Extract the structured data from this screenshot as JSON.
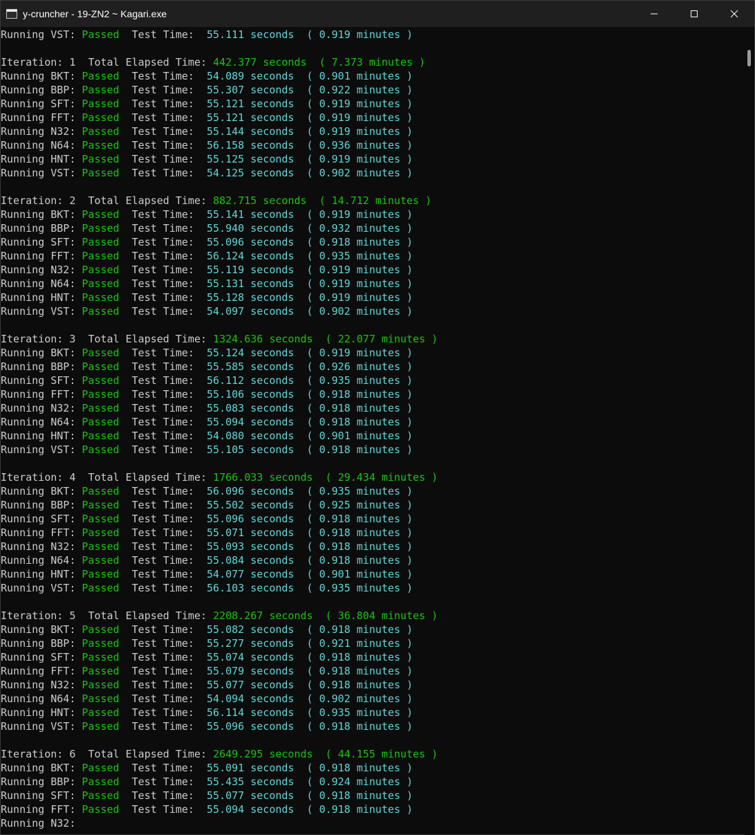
{
  "window": {
    "title": "y-cruncher - 19-ZN2 ~ Kagari.exe",
    "icon": "console-window-icon",
    "controls": [
      "minimize-icon",
      "maximize-icon",
      "close-icon"
    ]
  },
  "colors": {
    "background": "#0c0c0c",
    "titlebar": "#1f1f1f",
    "text": "#cccccc",
    "passed": "#16c60c",
    "time": "#61d6d6"
  },
  "labels": {
    "running": "Running",
    "passed": "Passed",
    "test_time": "Test Time:",
    "seconds": "seconds",
    "minutes": "minutes",
    "iteration": "Iteration:",
    "total_elapsed": "Total Elapsed Time:"
  },
  "terminal": {
    "lines": [
      {
        "type": "test",
        "test": "VST",
        "seconds": "55.111",
        "minutes": "0.919"
      },
      {
        "type": "blank"
      },
      {
        "type": "iter",
        "n": "1",
        "seconds": "442.377",
        "minutes": "7.373"
      },
      {
        "type": "test",
        "test": "BKT",
        "seconds": "54.089",
        "minutes": "0.901"
      },
      {
        "type": "test",
        "test": "BBP",
        "seconds": "55.307",
        "minutes": "0.922"
      },
      {
        "type": "test",
        "test": "SFT",
        "seconds": "55.121",
        "minutes": "0.919"
      },
      {
        "type": "test",
        "test": "FFT",
        "seconds": "55.121",
        "minutes": "0.919"
      },
      {
        "type": "test",
        "test": "N32",
        "seconds": "55.144",
        "minutes": "0.919"
      },
      {
        "type": "test",
        "test": "N64",
        "seconds": "56.158",
        "minutes": "0.936"
      },
      {
        "type": "test",
        "test": "HNT",
        "seconds": "55.125",
        "minutes": "0.919"
      },
      {
        "type": "test",
        "test": "VST",
        "seconds": "54.125",
        "minutes": "0.902"
      },
      {
        "type": "blank"
      },
      {
        "type": "iter",
        "n": "2",
        "seconds": "882.715",
        "minutes": "14.712"
      },
      {
        "type": "test",
        "test": "BKT",
        "seconds": "55.141",
        "minutes": "0.919"
      },
      {
        "type": "test",
        "test": "BBP",
        "seconds": "55.940",
        "minutes": "0.932"
      },
      {
        "type": "test",
        "test": "SFT",
        "seconds": "55.096",
        "minutes": "0.918"
      },
      {
        "type": "test",
        "test": "FFT",
        "seconds": "56.124",
        "minutes": "0.935"
      },
      {
        "type": "test",
        "test": "N32",
        "seconds": "55.119",
        "minutes": "0.919"
      },
      {
        "type": "test",
        "test": "N64",
        "seconds": "55.131",
        "minutes": "0.919"
      },
      {
        "type": "test",
        "test": "HNT",
        "seconds": "55.128",
        "minutes": "0.919"
      },
      {
        "type": "test",
        "test": "VST",
        "seconds": "54.097",
        "minutes": "0.902"
      },
      {
        "type": "blank"
      },
      {
        "type": "iter",
        "n": "3",
        "seconds": "1324.636",
        "minutes": "22.077"
      },
      {
        "type": "test",
        "test": "BKT",
        "seconds": "55.124",
        "minutes": "0.919"
      },
      {
        "type": "test",
        "test": "BBP",
        "seconds": "55.585",
        "minutes": "0.926"
      },
      {
        "type": "test",
        "test": "SFT",
        "seconds": "56.112",
        "minutes": "0.935"
      },
      {
        "type": "test",
        "test": "FFT",
        "seconds": "55.106",
        "minutes": "0.918"
      },
      {
        "type": "test",
        "test": "N32",
        "seconds": "55.083",
        "minutes": "0.918"
      },
      {
        "type": "test",
        "test": "N64",
        "seconds": "55.094",
        "minutes": "0.918"
      },
      {
        "type": "test",
        "test": "HNT",
        "seconds": "54.080",
        "minutes": "0.901"
      },
      {
        "type": "test",
        "test": "VST",
        "seconds": "55.105",
        "minutes": "0.918"
      },
      {
        "type": "blank"
      },
      {
        "type": "iter",
        "n": "4",
        "seconds": "1766.033",
        "minutes": "29.434"
      },
      {
        "type": "test",
        "test": "BKT",
        "seconds": "56.096",
        "minutes": "0.935"
      },
      {
        "type": "test",
        "test": "BBP",
        "seconds": "55.502",
        "minutes": "0.925"
      },
      {
        "type": "test",
        "test": "SFT",
        "seconds": "55.096",
        "minutes": "0.918"
      },
      {
        "type": "test",
        "test": "FFT",
        "seconds": "55.071",
        "minutes": "0.918"
      },
      {
        "type": "test",
        "test": "N32",
        "seconds": "55.093",
        "minutes": "0.918"
      },
      {
        "type": "test",
        "test": "N64",
        "seconds": "55.084",
        "minutes": "0.918"
      },
      {
        "type": "test",
        "test": "HNT",
        "seconds": "54.077",
        "minutes": "0.901"
      },
      {
        "type": "test",
        "test": "VST",
        "seconds": "56.103",
        "minutes": "0.935"
      },
      {
        "type": "blank"
      },
      {
        "type": "iter",
        "n": "5",
        "seconds": "2208.267",
        "minutes": "36.804"
      },
      {
        "type": "test",
        "test": "BKT",
        "seconds": "55.082",
        "minutes": "0.918"
      },
      {
        "type": "test",
        "test": "BBP",
        "seconds": "55.277",
        "minutes": "0.921"
      },
      {
        "type": "test",
        "test": "SFT",
        "seconds": "55.074",
        "minutes": "0.918"
      },
      {
        "type": "test",
        "test": "FFT",
        "seconds": "55.079",
        "minutes": "0.918"
      },
      {
        "type": "test",
        "test": "N32",
        "seconds": "55.077",
        "minutes": "0.918"
      },
      {
        "type": "test",
        "test": "N64",
        "seconds": "54.094",
        "minutes": "0.902"
      },
      {
        "type": "test",
        "test": "HNT",
        "seconds": "56.114",
        "minutes": "0.935"
      },
      {
        "type": "test",
        "test": "VST",
        "seconds": "55.096",
        "minutes": "0.918"
      },
      {
        "type": "blank"
      },
      {
        "type": "iter",
        "n": "6",
        "seconds": "2649.295",
        "minutes": "44.155"
      },
      {
        "type": "test",
        "test": "BKT",
        "seconds": "55.091",
        "minutes": "0.918"
      },
      {
        "type": "test",
        "test": "BBP",
        "seconds": "55.435",
        "minutes": "0.924"
      },
      {
        "type": "test",
        "test": "SFT",
        "seconds": "55.077",
        "minutes": "0.918"
      },
      {
        "type": "test",
        "test": "FFT",
        "seconds": "55.094",
        "minutes": "0.918"
      },
      {
        "type": "running",
        "test": "N32"
      }
    ]
  }
}
